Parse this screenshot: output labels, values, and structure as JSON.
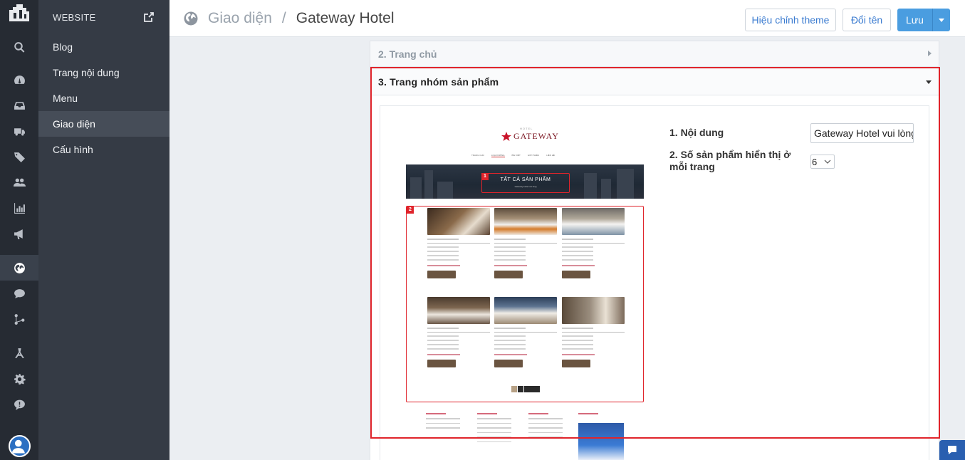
{
  "sidebar": {
    "section_title": "WEBSITE",
    "items": [
      {
        "label": "Blog"
      },
      {
        "label": "Trang nội dung"
      },
      {
        "label": "Menu"
      },
      {
        "label": "Giao diện"
      },
      {
        "label": "Cấu hình"
      }
    ]
  },
  "header": {
    "breadcrumb_parent": "Giao diện",
    "breadcrumb_separator": "/",
    "breadcrumb_current": "Gateway Hotel",
    "btn_edit_theme": "Hiệu chỉnh theme",
    "btn_rename": "Đổi tên",
    "btn_save": "Lưu"
  },
  "sections": {
    "home_title": "2. Trang chủ",
    "collection_title": "3. Trang nhóm sản phẩm"
  },
  "preview": {
    "badge1": "1",
    "badge2": "2",
    "banner_title": "TẤT CẢ SẢN PHẨM"
  },
  "form": {
    "content_label": "1. Nội dung",
    "content_value": "Gateway Hotel vui lòng",
    "per_page_label": "2. Số sản phẩm hiển thị ở mỗi trang",
    "per_page_value": "6"
  },
  "colors": {
    "highlight": "#e0242b",
    "primary": "#4a9de0",
    "rail_bg": "#262b33",
    "sidebar_bg": "#353b45"
  }
}
